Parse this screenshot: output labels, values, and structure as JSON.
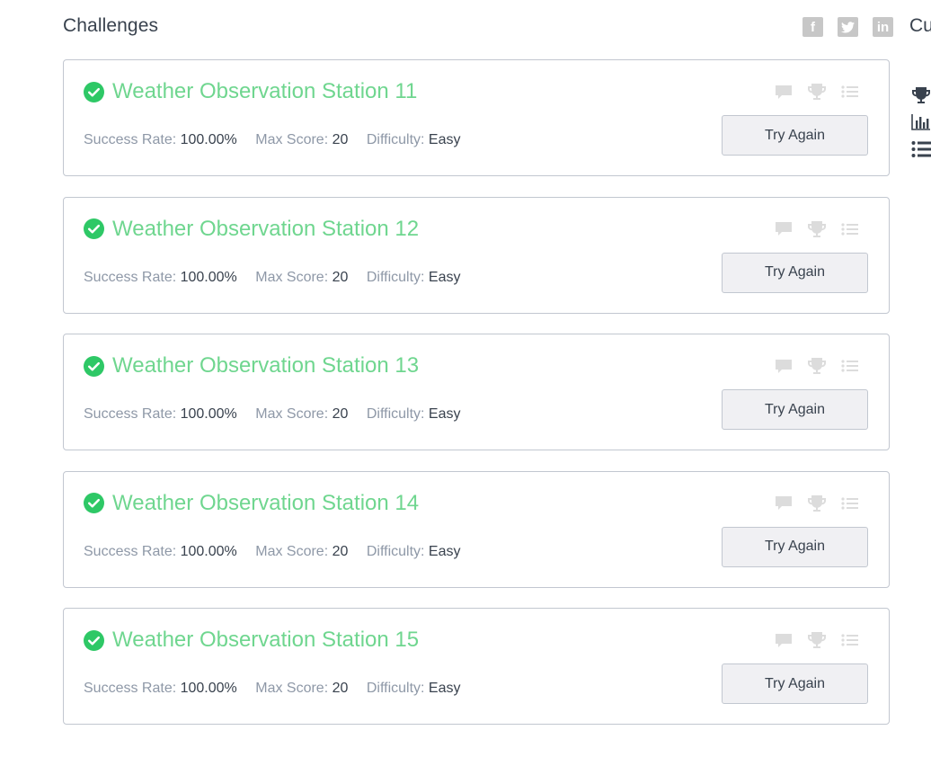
{
  "header": {
    "title": "Challenges",
    "right_heading": "Cu",
    "social": [
      {
        "icon": "facebook-icon",
        "glyph": "f"
      },
      {
        "icon": "twitter-icon",
        "glyph": "t"
      },
      {
        "icon": "linkedin-icon",
        "glyph": "in"
      }
    ]
  },
  "sidebar_icons": [
    "trophy-icon",
    "bar-chart-icon",
    "list-icon"
  ],
  "labels": {
    "success_rate": "Success Rate:",
    "max_score": "Max Score:",
    "difficulty": "Difficulty:"
  },
  "colors": {
    "solved_green": "#6fd68f",
    "check_green": "#2ec866",
    "muted_icon": "#dcdcdc"
  },
  "challenges": [
    {
      "title": "Weather Observation Station 11",
      "success_rate": "100.00%",
      "max_score": "20",
      "difficulty": "Easy",
      "button": "Try Again",
      "solved": true
    },
    {
      "title": "Weather Observation Station 12",
      "success_rate": "100.00%",
      "max_score": "20",
      "difficulty": "Easy",
      "button": "Try Again",
      "solved": true
    },
    {
      "title": "Weather Observation Station 13",
      "success_rate": "100.00%",
      "max_score": "20",
      "difficulty": "Easy",
      "button": "Try Again",
      "solved": true
    },
    {
      "title": "Weather Observation Station 14",
      "success_rate": "100.00%",
      "max_score": "20",
      "difficulty": "Easy",
      "button": "Try Again",
      "solved": true
    },
    {
      "title": "Weather Observation Station 15",
      "success_rate": "100.00%",
      "max_score": "20",
      "difficulty": "Easy",
      "button": "Try Again",
      "solved": true
    }
  ]
}
